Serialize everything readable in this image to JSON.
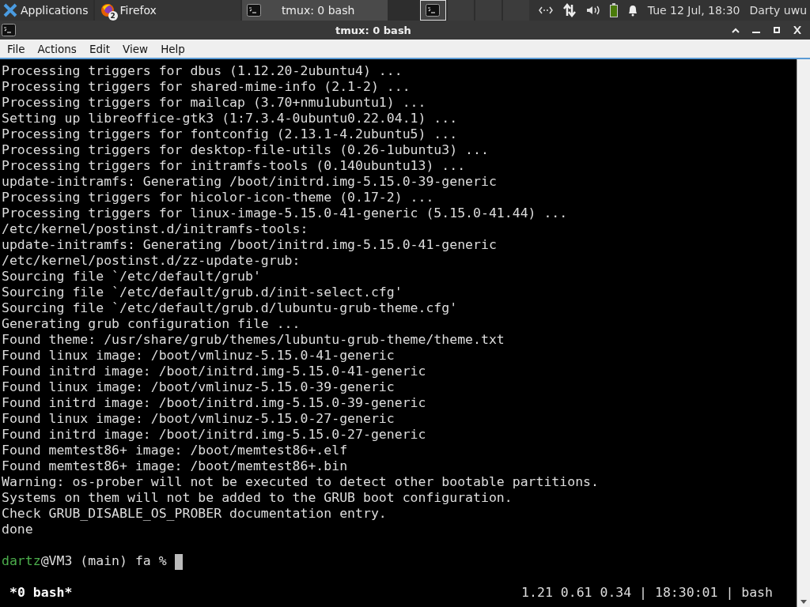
{
  "taskbar": {
    "app_menu": "Applications",
    "tasks": [
      {
        "label": "Firefox",
        "kind": "browser",
        "badge": "2",
        "selected": false
      },
      {
        "label": "tmux: 0 bash",
        "kind": "terminal",
        "selected": true
      }
    ],
    "workspaces": [
      {
        "selected": true
      },
      {
        "selected": false
      },
      {
        "selected": false
      },
      {
        "selected": false
      }
    ],
    "clock": "Tue 12 Jul, 18:30",
    "user": "Darty uwu"
  },
  "window": {
    "title": "tmux: 0 bash",
    "menu": [
      "File",
      "Actions",
      "Edit",
      "View",
      "Help"
    ],
    "terminal": {
      "lines": [
        "Processing triggers for dbus (1.12.20-2ubuntu4) ...",
        "Processing triggers for shared-mime-info (2.1-2) ...",
        "Processing triggers for mailcap (3.70+nmu1ubuntu1) ...",
        "Setting up libreoffice-gtk3 (1:7.3.4-0ubuntu0.22.04.1) ...",
        "Processing triggers for fontconfig (2.13.1-4.2ubuntu5) ...",
        "Processing triggers for desktop-file-utils (0.26-1ubuntu3) ...",
        "Processing triggers for initramfs-tools (0.140ubuntu13) ...",
        "update-initramfs: Generating /boot/initrd.img-5.15.0-39-generic",
        "Processing triggers for hicolor-icon-theme (0.17-2) ...",
        "Processing triggers for linux-image-5.15.0-41-generic (5.15.0-41.44) ...",
        "/etc/kernel/postinst.d/initramfs-tools:",
        "update-initramfs: Generating /boot/initrd.img-5.15.0-41-generic",
        "/etc/kernel/postinst.d/zz-update-grub:",
        "Sourcing file `/etc/default/grub'",
        "Sourcing file `/etc/default/grub.d/init-select.cfg'",
        "Sourcing file `/etc/default/grub.d/lubuntu-grub-theme.cfg'",
        "Generating grub configuration file ...",
        "Found theme: /usr/share/grub/themes/lubuntu-grub-theme/theme.txt",
        "Found linux image: /boot/vmlinuz-5.15.0-41-generic",
        "Found initrd image: /boot/initrd.img-5.15.0-41-generic",
        "Found linux image: /boot/vmlinuz-5.15.0-39-generic",
        "Found initrd image: /boot/initrd.img-5.15.0-39-generic",
        "Found linux image: /boot/vmlinuz-5.15.0-27-generic",
        "Found initrd image: /boot/initrd.img-5.15.0-27-generic",
        "Found memtest86+ image: /boot/memtest86+.elf",
        "Found memtest86+ image: /boot/memtest86+.bin",
        "Warning: os-prober will not be executed to detect other bootable partitions.",
        "Systems on them will not be added to the GRUB boot configuration.",
        "Check GRUB_DISABLE_OS_PROBER documentation entry.",
        "done"
      ],
      "prompt": {
        "user": "dartz",
        "rest": "@VM3 (main) fa %"
      },
      "status": {
        "left": "*0 bash*",
        "right": "1.21 0.61 0.34 | 18:30:01 | bash"
      }
    }
  }
}
